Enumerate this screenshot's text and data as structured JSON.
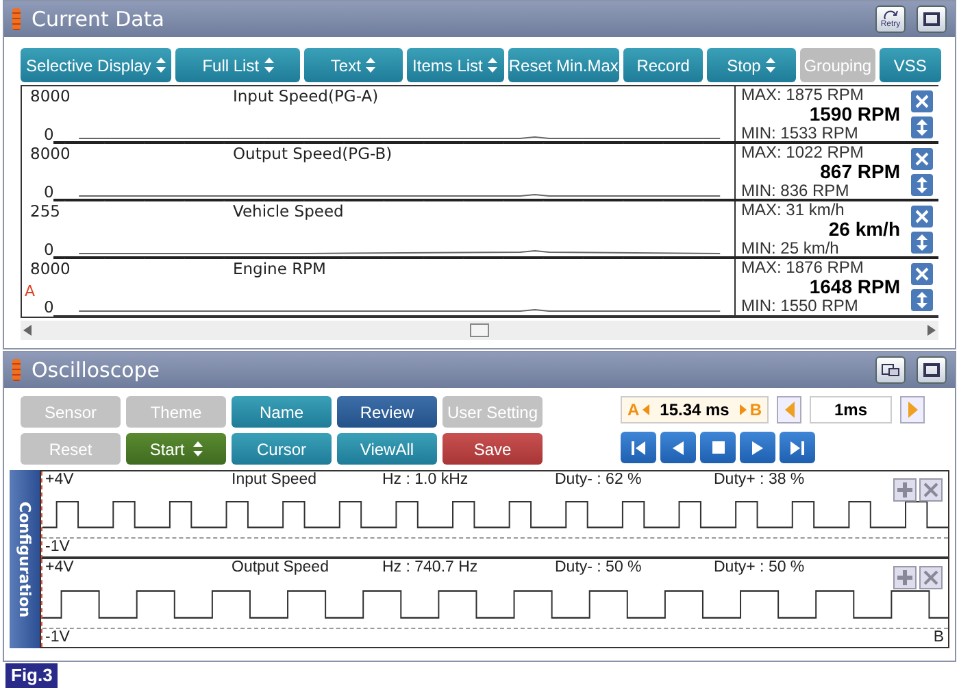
{
  "current_data": {
    "title": "Current Data",
    "retry_label": "Retry",
    "toolbar": [
      {
        "label": "Selective Display",
        "dropdown": true,
        "disabled": false
      },
      {
        "label": "Full List",
        "dropdown": true,
        "disabled": false
      },
      {
        "label": "Text",
        "dropdown": true,
        "disabled": false
      },
      {
        "label": "Items List",
        "dropdown": true,
        "disabled": false
      },
      {
        "label": "Reset Min.Max",
        "dropdown": false,
        "disabled": false
      },
      {
        "label": "Record",
        "dropdown": false,
        "disabled": false
      },
      {
        "label": "Stop",
        "dropdown": true,
        "disabled": false
      },
      {
        "label": "Grouping",
        "dropdown": false,
        "disabled": true
      },
      {
        "label": "VSS",
        "dropdown": false,
        "disabled": false
      }
    ],
    "rows": [
      {
        "scale_max": "8000",
        "name": "Input Speed(PG-A)",
        "scale_min": "0",
        "max": "MAX:  1875 RPM",
        "value": "1590 RPM",
        "min": "MIN:  1533 RPM"
      },
      {
        "scale_max": "8000",
        "name": "Output Speed(PG-B)",
        "scale_min": "0",
        "max": "MAX:  1022 RPM",
        "value": "867 RPM",
        "min": "MIN:   836 RPM"
      },
      {
        "scale_max": "255",
        "name": "Vehicle Speed",
        "scale_min": "0",
        "max": "MAX:      31 km/h",
        "value": "26 km/h",
        "min": "MIN:     25 km/h"
      },
      {
        "scale_max": "8000",
        "name": "Engine RPM",
        "scale_min": "0",
        "marker": "A",
        "max": "MAX:  1876 RPM",
        "value": "1648 RPM",
        "min": "MIN:  1550 RPM"
      }
    ]
  },
  "oscilloscope": {
    "title": "Oscilloscope",
    "buttons": [
      [
        {
          "label": "Sensor",
          "kind": "disabled",
          "dropdown": false
        },
        {
          "label": "Theme",
          "kind": "disabled",
          "dropdown": false
        },
        {
          "label": "Name",
          "kind": "normal",
          "dropdown": false
        },
        {
          "label": "Review",
          "kind": "selected",
          "dropdown": false
        },
        {
          "label": "User Setting",
          "kind": "disabled",
          "dropdown": false
        }
      ],
      [
        {
          "label": "Reset",
          "kind": "disabled",
          "dropdown": false
        },
        {
          "label": "Start",
          "kind": "run",
          "dropdown": true
        },
        {
          "label": "Cursor",
          "kind": "normal",
          "dropdown": false
        },
        {
          "label": "ViewAll",
          "kind": "normal",
          "dropdown": false
        },
        {
          "label": "Save",
          "kind": "save",
          "dropdown": false
        }
      ]
    ],
    "cursor": {
      "a": "A",
      "value": "15.34 ms",
      "b": "B"
    },
    "timebase": "1ms",
    "side_tab": "Configuration",
    "channels": [
      {
        "top": "+4V",
        "name": "Input Speed",
        "hz": "Hz : 1.0 kHz",
        "duty_minus": "Duty- : 62 %",
        "duty_plus": "Duty+ : 38 %",
        "bottom": "-1V"
      },
      {
        "top": "+4V",
        "name": "Output Speed",
        "hz": "Hz : 740.7 Hz",
        "duty_minus": "Duty- : 50 %",
        "duty_plus": "Duty+ : 50 %",
        "bottom": "-1V",
        "marker": "B"
      }
    ]
  },
  "figure_label": "Fig.3"
}
